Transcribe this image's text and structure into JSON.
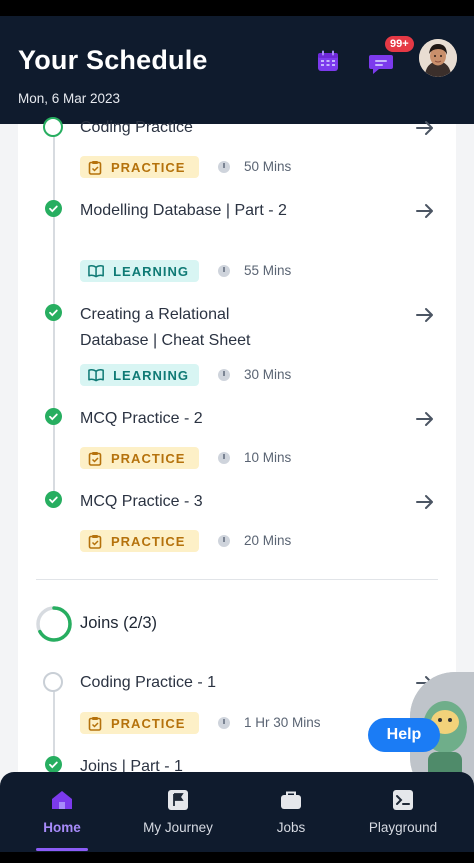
{
  "header": {
    "title": "Your Schedule",
    "date": "Mon, 6 Mar 2023",
    "notification_badge": "99+"
  },
  "items": [
    {
      "title": "Coding Practice",
      "tag": "PRACTICE",
      "duration": "50 Mins",
      "status": "in-progress"
    },
    {
      "title": "Modelling Database | Part - 2",
      "tag": "LEARNING",
      "duration": "55 Mins",
      "status": "completed"
    },
    {
      "title": "Creating a Relational Database | Cheat Sheet",
      "tag": "LEARNING",
      "duration": "30 Mins",
      "status": "completed"
    },
    {
      "title": "MCQ Practice - 2",
      "tag": "PRACTICE",
      "duration": "10 Mins",
      "status": "completed"
    },
    {
      "title": "MCQ Practice - 3",
      "tag": "PRACTICE",
      "duration": "20 Mins",
      "status": "completed"
    }
  ],
  "section": {
    "title": "Joins (2/3)",
    "progress": 0.67,
    "items": [
      {
        "title": "Coding Practice - 1",
        "tag": "PRACTICE",
        "duration": "1 Hr 30 Mins",
        "status": "not-started"
      },
      {
        "title": "Joins | Part - 1",
        "status": "completed"
      }
    ]
  },
  "help_label": "Help",
  "nav": [
    {
      "label": "Home",
      "icon": "home-icon",
      "active": true
    },
    {
      "label": "My Journey",
      "icon": "flag-icon",
      "active": false
    },
    {
      "label": "Jobs",
      "icon": "briefcase-icon",
      "active": false
    },
    {
      "label": "Playground",
      "icon": "terminal-icon",
      "active": false
    }
  ],
  "colors": {
    "header_bg": "#0f1b2d",
    "accent": "#8b5cf6",
    "complete": "#27ae60",
    "practice_tag": "#b5720c",
    "learning_tag": "#0f7a75",
    "help": "#1b7cf5"
  }
}
